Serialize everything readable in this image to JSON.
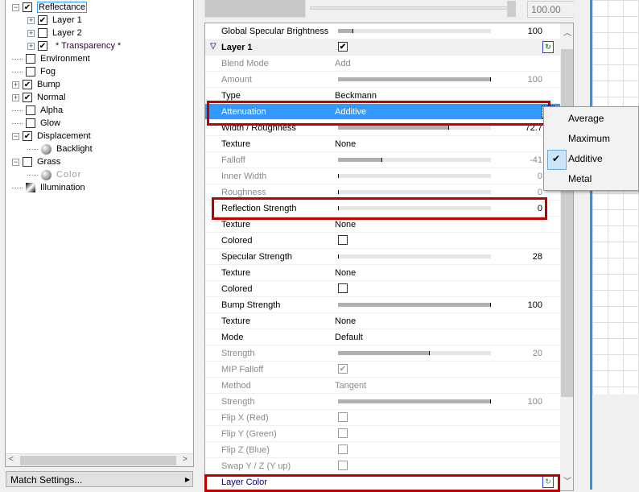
{
  "tree": {
    "items": [
      {
        "label": "Reflectance",
        "checked": true,
        "expander": "minus"
      },
      {
        "label": "Layer 1",
        "checked": true,
        "expander": "plus"
      },
      {
        "label": "Layer 2",
        "checked": false,
        "expander": "plus"
      },
      {
        "label": "* Transparency *",
        "checked": true,
        "expander": "plus"
      },
      {
        "label": "Environment",
        "checked": false
      },
      {
        "label": "Fog",
        "checked": false
      },
      {
        "label": "Bump",
        "checked": true,
        "expander": "plus"
      },
      {
        "label": "Normal",
        "checked": true,
        "expander": "plus"
      },
      {
        "label": "Alpha",
        "checked": false
      },
      {
        "label": "Glow",
        "checked": false
      },
      {
        "label": "Displacement",
        "checked": true,
        "expander": "minus"
      },
      {
        "label": "Backlight",
        "icon": "sphere-icon"
      },
      {
        "label": "Grass",
        "checked": false,
        "expander": "minus"
      },
      {
        "label": "Color",
        "icon": "sphere-icon",
        "disabled": true
      },
      {
        "label": "Illumination",
        "icon": "illumination-icon"
      }
    ]
  },
  "match_settings": "Match Settings...",
  "top": {
    "value": "100.00",
    "slider_percent": 100
  },
  "props": [
    {
      "label": "Global Specular Brightness",
      "slider": 10,
      "num": "100"
    },
    {
      "label": "Layer 1",
      "head": true,
      "checked": true
    },
    {
      "label": "Blend Mode",
      "value": "Add",
      "dis": true
    },
    {
      "label": "Amount",
      "slider": 100,
      "num": "100",
      "dis": true
    },
    {
      "label": "Type",
      "value": "Beckmann"
    },
    {
      "label": "Attenuation",
      "value": "Additive",
      "sel": true
    },
    {
      "label": "Width / Roughness",
      "slider": 72.7,
      "num": "72.7"
    },
    {
      "label": "Texture",
      "value": "None"
    },
    {
      "label": "Falloff",
      "slider": 29,
      "num": "-41",
      "dis": true
    },
    {
      "label": "Inner Width",
      "slider": 0,
      "num": "0",
      "dis": true
    },
    {
      "label": "Roughness",
      "slider": 0,
      "num": "0",
      "dis": true
    },
    {
      "label": "Reflection Strength",
      "slider": 0,
      "num": "0"
    },
    {
      "label": "Texture",
      "value": "None"
    },
    {
      "label": "Colored",
      "checkbox": false
    },
    {
      "label": "Specular Strength",
      "slider": 0.5,
      "num": "28"
    },
    {
      "label": "Texture",
      "value": "None"
    },
    {
      "label": "Colored",
      "checkbox": false
    },
    {
      "label": "Bump Strength",
      "slider": 100,
      "num": "100"
    },
    {
      "label": "Texture",
      "value": "None"
    },
    {
      "label": "Mode",
      "value": "Default"
    },
    {
      "label": "Strength",
      "slider": 60,
      "num": "20",
      "dis": true
    },
    {
      "label": "MIP Falloff",
      "checkbox": true,
      "dis": true
    },
    {
      "label": "Method",
      "value": "Tangent",
      "dis": true
    },
    {
      "label": "Strength",
      "slider": 100,
      "num": "100",
      "dis": true
    },
    {
      "label": "Flip X (Red)",
      "checkbox": false,
      "dis": true
    },
    {
      "label": "Flip Y (Green)",
      "checkbox": false,
      "dis": true
    },
    {
      "label": "Flip Z (Blue)",
      "checkbox": false,
      "dis": true
    },
    {
      "label": "Swap Y / Z (Y up)",
      "checkbox": false,
      "dis": true
    },
    {
      "label": "Layer Color",
      "load": true,
      "color": "#000080"
    }
  ],
  "menu": {
    "items": [
      "Average",
      "Maximum",
      "Additive",
      "Metal"
    ],
    "checked": "Additive"
  },
  "colors": {
    "selection": "#3399ff",
    "highlight_box": "#c00000"
  }
}
